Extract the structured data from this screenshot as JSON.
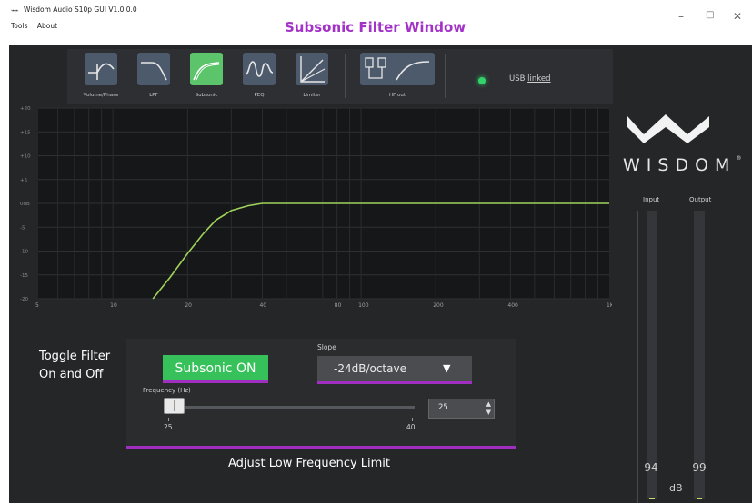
{
  "window": {
    "title": "Wisdom Audio S10p GUI V1.0.0.0",
    "menu": [
      "Tools",
      "About"
    ],
    "annotation_title": "Subsonic Filter Window",
    "minimize": "–",
    "maximize": "□",
    "close": "✕"
  },
  "toolbar": {
    "tools": [
      {
        "label": "Volume/Phase",
        "icon": "volume-phase-icon"
      },
      {
        "label": "LPF",
        "icon": "lpf-curve-icon"
      },
      {
        "label": "Subsonic",
        "icon": "subsonic-curve-icon",
        "active": true
      },
      {
        "label": "PEQ",
        "icon": "peq-curve-icon"
      },
      {
        "label": "Limiter",
        "icon": "limiter-icon"
      },
      {
        "label": "HF out",
        "icon": "hf-out-icon"
      }
    ],
    "usb_status_prefix": "USB",
    "usb_status_link": "linked",
    "active_color": "#5cc46a",
    "led_color": "#31d36a"
  },
  "brand": {
    "name": "WISDOM",
    "trademark": "®"
  },
  "graph": {
    "y_ticks": [
      "+20",
      "+15",
      "+10",
      "+5",
      "0dB",
      "-5",
      "-10",
      "-15",
      "-20"
    ],
    "x_ticks": [
      "5",
      "10",
      "20",
      "40",
      "80",
      "100",
      "200",
      "400",
      "1K"
    ],
    "curve_color": "#9fd35a"
  },
  "chart_data": {
    "type": "line",
    "xlabel": "",
    "ylabel": "",
    "x_scale": "log",
    "xlim": [
      5,
      1000
    ],
    "ylim": [
      -20,
      20
    ],
    "grid": true,
    "series": [
      {
        "x": [
          14.5,
          17,
          20,
          23,
          26,
          30,
          35,
          40,
          60,
          100,
          200,
          400,
          1000
        ],
        "y": [
          -20,
          -15.5,
          -10.5,
          -6.5,
          -3.5,
          -1.5,
          -0.5,
          0,
          0,
          0,
          0,
          0,
          0
        ]
      }
    ]
  },
  "filter": {
    "toggle_annotation_line1": "Toggle Filter",
    "toggle_annotation_line2": "On and Off",
    "subsonic_button": "Subsonic ON",
    "slope_label": "Slope",
    "slope_value": "-24dB/octave",
    "frequency_label": "Frequency (Hz)",
    "slider_min": "25",
    "slider_max": "40",
    "frequency_value": "25",
    "adjust_annotation": "Adjust Low Frequency Limit",
    "highlight_color": "#a02ec0",
    "button_color": "#37c15a"
  },
  "meters": {
    "input_label": "Input",
    "output_label": "Output",
    "input_value": "-94",
    "output_value": "-99",
    "unit": "dB"
  }
}
